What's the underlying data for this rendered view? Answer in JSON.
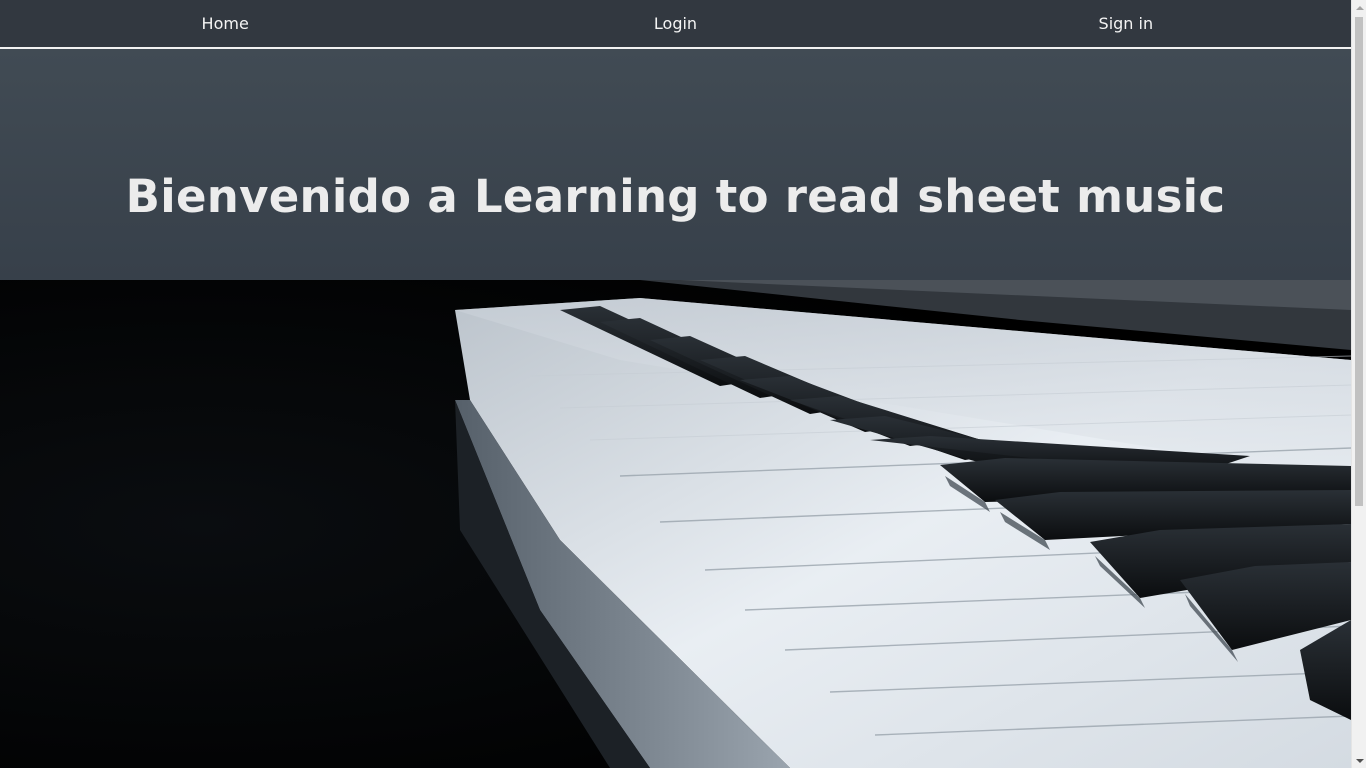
{
  "nav": {
    "items": [
      {
        "label": "Home"
      },
      {
        "label": "Login"
      },
      {
        "label": "Sign in"
      }
    ]
  },
  "hero": {
    "title": "Bienvenido a Learning to read sheet music"
  },
  "colors": {
    "nav_bg": "#323840",
    "hero_bg": "#3b444d",
    "text": "#ececec"
  }
}
